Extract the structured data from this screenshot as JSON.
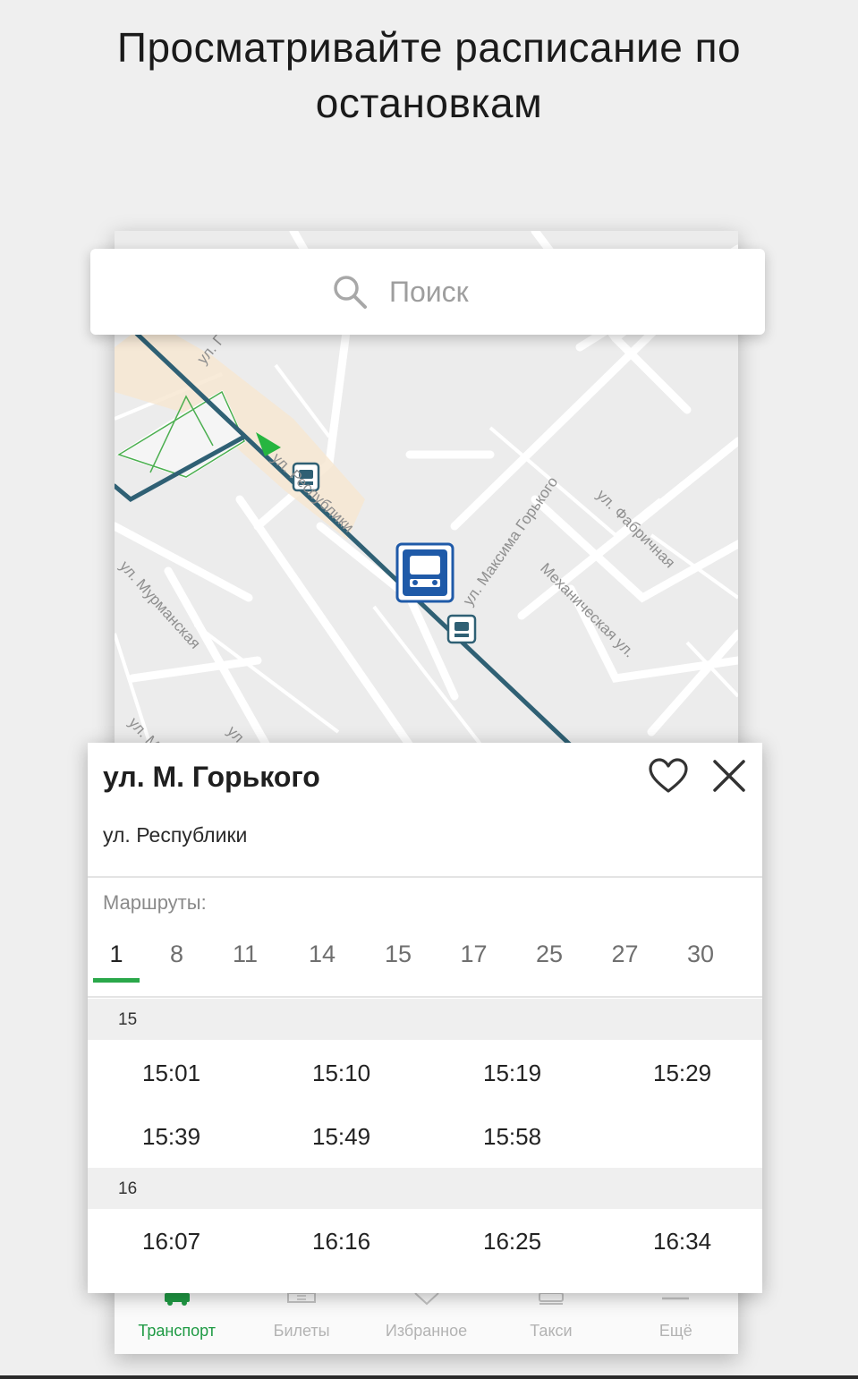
{
  "headline": {
    "line1": "Просматривайте расписание по",
    "line2": "остановкам"
  },
  "search": {
    "placeholder": "Поиск",
    "icon": "search-icon"
  },
  "map": {
    "street_labels": {
      "gorkogo": "ул. Максима Горького",
      "fabrichnaya": "ул. Фабричная",
      "mekhanicheskaya": "Механическая ул.",
      "murmanskaya": "ул. Мурманская",
      "respubliki": "ул. Республики",
      "top_partial": "ул. Г",
      "bottom_partial1": "ул. М",
      "bottom_partial2": "ул"
    },
    "colors": {
      "route_line": "#2f6074",
      "stop_marker": "#1f5aa8",
      "location_arrow": "#26b540",
      "park": "#4caf50",
      "highlight": "#f7e8d2"
    }
  },
  "stop": {
    "title": "ул. М. Горького",
    "subtitle": "ул. Республики",
    "routes_label": "Маршруты:",
    "routes": [
      "1",
      "8",
      "11",
      "14",
      "15",
      "17",
      "25",
      "27",
      "30"
    ],
    "active_route": "1",
    "accent_color": "#2aa84a"
  },
  "schedule": [
    {
      "hour": "15",
      "times": [
        "15:01",
        "15:10",
        "15:19",
        "15:29",
        "15:39",
        "15:49",
        "15:58"
      ]
    },
    {
      "hour": "16",
      "times": [
        "16:07",
        "16:16",
        "16:25",
        "16:34"
      ]
    }
  ],
  "nav": {
    "items": [
      {
        "label": "Транспорт",
        "icon": "bus-icon",
        "active": true
      },
      {
        "label": "Билеты",
        "icon": "ticket-icon",
        "active": false
      },
      {
        "label": "Избранное",
        "icon": "heart-icon",
        "active": false
      },
      {
        "label": "Такси",
        "icon": "taxi-icon",
        "active": false
      },
      {
        "label": "Ещё",
        "icon": "more-icon",
        "active": false
      }
    ]
  }
}
